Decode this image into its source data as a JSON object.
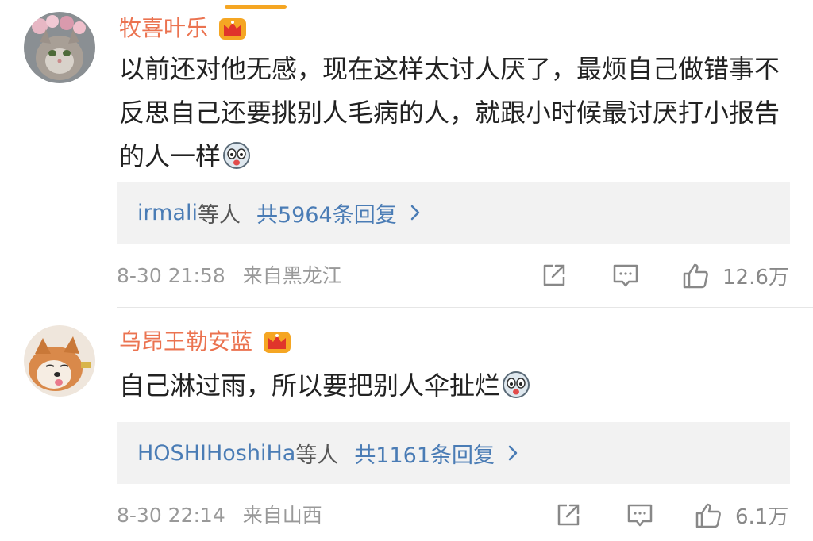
{
  "colors": {
    "username": "#eb7350",
    "link": "#4a7cb5",
    "meta": "#999999",
    "reply_bg": "#f2f2f2",
    "crown": "#f5a623"
  },
  "comments": [
    {
      "username": "牧喜叶乐",
      "badge_icon": "crown-badge-icon",
      "text": "以前还对他无感，现在这样太讨人厌了，最烦自己做错事不反思自己还要挑别人毛病的人，就跟小时候最讨厌打小报告的人一样",
      "emoji_icon": "sticker-emoji-icon",
      "reply_users": "irmali",
      "reply_suffix": "等人",
      "reply_count": "共5964条回复",
      "time": "8-30 21:58",
      "location": "来自黑龙江",
      "likes": "12.6万"
    },
    {
      "username": "乌昂王勒安蓝",
      "badge_icon": "crown-badge-icon",
      "text": "自己淋过雨，所以要把别人伞扯烂",
      "emoji_icon": "sticker-emoji-icon",
      "reply_users": "HOSHIHoshiHa",
      "reply_suffix": "等人",
      "reply_count": "共1161条回复",
      "time": "8-30 22:14",
      "location": "来自山西",
      "likes": "6.1万"
    }
  ]
}
